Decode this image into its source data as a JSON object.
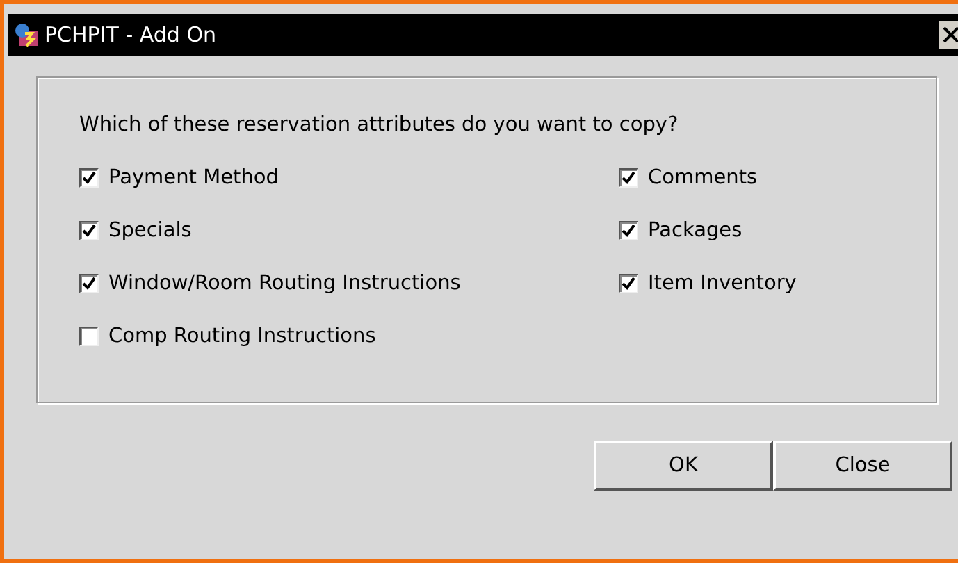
{
  "window": {
    "title": "PCHPIT - Add On"
  },
  "prompt": "Which of these reservation attributes do you want to copy?",
  "option_columns": [
    [
      {
        "label": "Payment Method",
        "checked": true
      },
      {
        "label": "Specials",
        "checked": true
      },
      {
        "label": "Window/Room Routing Instructions",
        "checked": true
      },
      {
        "label": "Comp Routing Instructions",
        "checked": false
      }
    ],
    [
      {
        "label": "Comments",
        "checked": true
      },
      {
        "label": "Packages",
        "checked": true
      },
      {
        "label": "Item Inventory",
        "checked": true
      }
    ]
  ],
  "buttons": [
    "OK",
    "Close"
  ]
}
